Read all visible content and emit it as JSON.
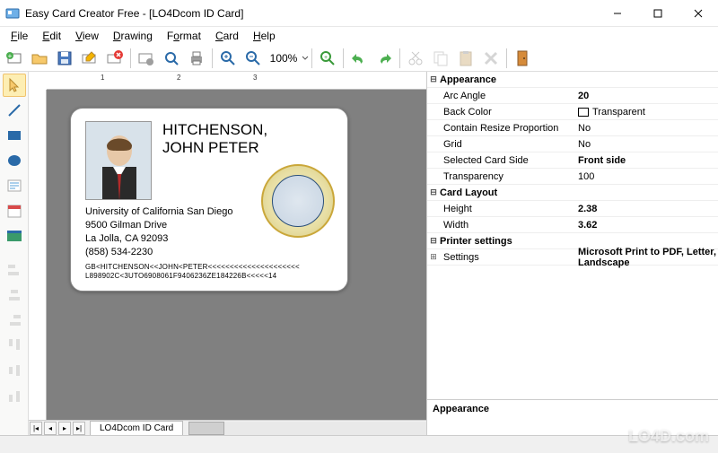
{
  "window": {
    "title": "Easy Card Creator Free - [LO4Dcom ID Card]"
  },
  "menu": {
    "file": "File",
    "edit": "Edit",
    "view": "View",
    "drawing": "Drawing",
    "format": "Format",
    "card": "Card",
    "help": "Help"
  },
  "toolbar": {
    "zoom": "100%"
  },
  "tabs": {
    "sheet": "LO4Dcom ID Card"
  },
  "card": {
    "name_line1": "HITCHENSON,",
    "name_line2": "JOHN PETER",
    "addr_line1": "University of California San Diego",
    "addr_line2": "9500 Gilman Drive",
    "addr_line3": "La Jolla, CA 92093",
    "addr_line4": "(858) 534-2230",
    "mrz_line1": "GB<HITCHENSON<<JOHN<PETER<<<<<<<<<<<<<<<<<<<<<",
    "mrz_line2": "L898902C<3UTO6908061F9406236ZE184226B<<<<<14"
  },
  "props": {
    "cat_appearance": "Appearance",
    "arc_angle_k": "Arc Angle",
    "arc_angle_v": "20",
    "back_color_k": "Back Color",
    "back_color_v": "Transparent",
    "contain_resize_k": "Contain Resize Proportion",
    "contain_resize_v": "No",
    "grid_k": "Grid",
    "grid_v": "No",
    "selected_side_k": "Selected Card Side",
    "selected_side_v": "Front side",
    "transparency_k": "Transparency",
    "transparency_v": "100",
    "cat_layout": "Card Layout",
    "height_k": "Height",
    "height_v": "2.38",
    "width_k": "Width",
    "width_v": "3.62",
    "cat_printer": "Printer settings",
    "settings_k": "Settings",
    "settings_v": "Microsoft Print to PDF, Letter, Landscape"
  },
  "desc": {
    "title": "Appearance"
  },
  "watermark": "LO4D.com"
}
